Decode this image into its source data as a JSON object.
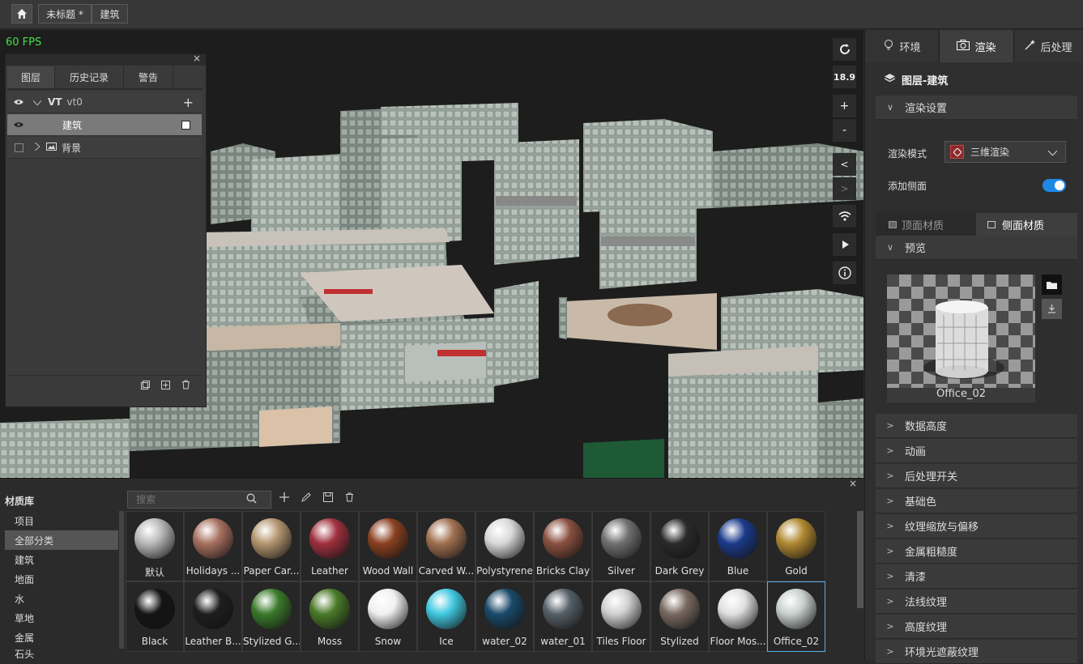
{
  "topbar": {
    "crumb1": "未标题 *",
    "crumb2": "建筑"
  },
  "viewport": {
    "fps": "60 FPS",
    "zoom": "18.9",
    "zoom_in": "+",
    "zoom_out": "-",
    "prev": "<",
    "next": ">"
  },
  "layers_panel": {
    "close": "×",
    "tabs": [
      "图层",
      "历史记录",
      "警告"
    ],
    "rows": [
      {
        "label": "VT",
        "sub": "vt0"
      },
      {
        "label": "建筑"
      },
      {
        "label": "背景"
      }
    ],
    "add": "+"
  },
  "right_panel": {
    "tabs": [
      "环境",
      "渲染",
      "后处理"
    ],
    "layer_title": "图层-建筑",
    "render_settings": "渲染设置",
    "render_mode_label": "渲染模式",
    "render_mode_value": "三维渲染",
    "side_label": "添加侧面",
    "subtabs": [
      "顶面材质",
      "侧面材质"
    ],
    "preview": "预览",
    "preview_name": "Office_02",
    "sections": [
      "数据高度",
      "动画",
      "后处理开关",
      "基础色",
      "纹理缩放与偏移",
      "金属粗糙度",
      "清漆",
      "法线纹理",
      "高度纹理",
      "环境光遮蔽纹理"
    ]
  },
  "material_library": {
    "title": "材质库",
    "close": "×",
    "search_placeholder": "搜索",
    "categories": [
      "项目",
      "全部分类",
      "建筑",
      "地面",
      "水",
      "草地",
      "金属",
      "石头"
    ],
    "materials": [
      {
        "name": "默认",
        "color": "#b8b8b8"
      },
      {
        "name": "Holidays ...",
        "color": "#a87060"
      },
      {
        "name": "Paper Car...",
        "color": "#b49570"
      },
      {
        "name": "Leather",
        "color": "#a0303e"
      },
      {
        "name": "Wood Wall",
        "color": "#8a4020"
      },
      {
        "name": "Carved W...",
        "color": "#a07050"
      },
      {
        "name": "Polystyrene",
        "color": "#d8d8d8"
      },
      {
        "name": "Bricks Clay",
        "color": "#8a5040"
      },
      {
        "name": "Silver",
        "color": "#707070"
      },
      {
        "name": "Dark Grey",
        "color": "#2a2a2a"
      },
      {
        "name": "Blue",
        "color": "#1a3a8a"
      },
      {
        "name": "Gold",
        "color": "#b08830"
      },
      {
        "name": "Black",
        "color": "#151515"
      },
      {
        "name": "Leather B...",
        "color": "#1e1e1e"
      },
      {
        "name": "Stylized G...",
        "color": "#3a7a2a"
      },
      {
        "name": "Moss",
        "color": "#4a7a28"
      },
      {
        "name": "Snow",
        "color": "#f0f0f0"
      },
      {
        "name": "Ice",
        "color": "#40c8e0"
      },
      {
        "name": "water_02",
        "color": "#1a4a6a"
      },
      {
        "name": "water_01",
        "color": "#556068"
      },
      {
        "name": "Tiles Floor",
        "color": "#d0d0d0"
      },
      {
        "name": "Stylized",
        "color": "#7a6a60"
      },
      {
        "name": "Floor Mos...",
        "color": "#e0e0e0"
      },
      {
        "name": "Office_02",
        "color": "#c8d0cc"
      }
    ]
  },
  "colors": {
    "accent": "#1e88e5",
    "fps": "#46e046",
    "panel": "#3a3a3a"
  }
}
